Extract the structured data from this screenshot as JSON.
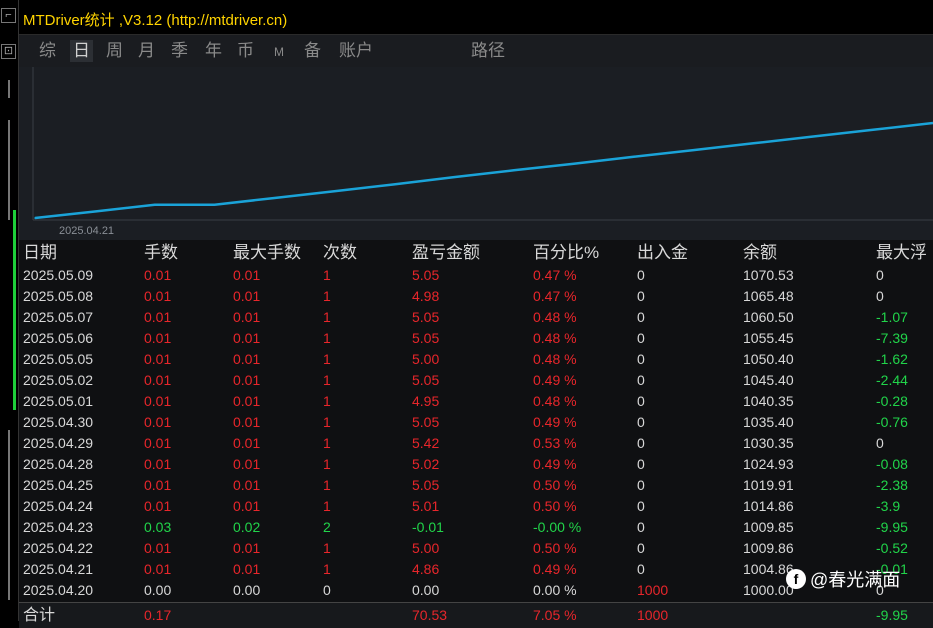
{
  "window": {
    "title": "MTDriver统计 ,V3.12 (http://mtdriver.cn)"
  },
  "tabs": [
    {
      "label": "综"
    },
    {
      "label": "日",
      "active": true
    },
    {
      "label": "周"
    },
    {
      "label": "月"
    },
    {
      "label": "季"
    },
    {
      "label": "年"
    },
    {
      "label": "币"
    },
    {
      "label": "M"
    },
    {
      "label": "备"
    },
    {
      "label": "账户"
    },
    {
      "label": "路径"
    }
  ],
  "chart_data": {
    "type": "line",
    "x": [
      "2025.04.20",
      "2025.04.21",
      "2025.04.22",
      "2025.04.23",
      "2025.04.24",
      "2025.04.25",
      "2025.04.28",
      "2025.04.29",
      "2025.04.30",
      "2025.05.01",
      "2025.05.02",
      "2025.05.05",
      "2025.05.06",
      "2025.05.07",
      "2025.05.08",
      "2025.05.09"
    ],
    "series": [
      {
        "values": [
          1000.0,
          1004.86,
          1009.86,
          1009.85,
          1014.86,
          1019.91,
          1024.93,
          1030.35,
          1035.4,
          1040.35,
          1045.4,
          1050.4,
          1055.45,
          1060.5,
          1065.48,
          1070.53
        ]
      }
    ],
    "start_label": "2025.04.21",
    "line_color": "#1aa3d8"
  },
  "table": {
    "headers": [
      "日期",
      "手数",
      "最大手数",
      "次数",
      "盈亏金额",
      "百分比%",
      "出入金",
      "余额",
      "最大浮"
    ],
    "rows": [
      [
        "2025.05.09",
        "0.01",
        "0.01",
        "1",
        "5.05",
        "0.47 %",
        "0",
        "1070.53",
        "0"
      ],
      [
        "2025.05.08",
        "0.01",
        "0.01",
        "1",
        "4.98",
        "0.47 %",
        "0",
        "1065.48",
        "0"
      ],
      [
        "2025.05.07",
        "0.01",
        "0.01",
        "1",
        "5.05",
        "0.48 %",
        "0",
        "1060.50",
        "-1.07"
      ],
      [
        "2025.05.06",
        "0.01",
        "0.01",
        "1",
        "5.05",
        "0.48 %",
        "0",
        "1055.45",
        "-7.39"
      ],
      [
        "2025.05.05",
        "0.01",
        "0.01",
        "1",
        "5.00",
        "0.48 %",
        "0",
        "1050.40",
        "-1.62"
      ],
      [
        "2025.05.02",
        "0.01",
        "0.01",
        "1",
        "5.05",
        "0.49 %",
        "0",
        "1045.40",
        "-2.44"
      ],
      [
        "2025.05.01",
        "0.01",
        "0.01",
        "1",
        "4.95",
        "0.48 %",
        "0",
        "1040.35",
        "-0.28"
      ],
      [
        "2025.04.30",
        "0.01",
        "0.01",
        "1",
        "5.05",
        "0.49 %",
        "0",
        "1035.40",
        "-0.76"
      ],
      [
        "2025.04.29",
        "0.01",
        "0.01",
        "1",
        "5.42",
        "0.53 %",
        "0",
        "1030.35",
        "0"
      ],
      [
        "2025.04.28",
        "0.01",
        "0.01",
        "1",
        "5.02",
        "0.49 %",
        "0",
        "1024.93",
        "-0.08"
      ],
      [
        "2025.04.25",
        "0.01",
        "0.01",
        "1",
        "5.05",
        "0.50 %",
        "0",
        "1019.91",
        "-2.38"
      ],
      [
        "2025.04.24",
        "0.01",
        "0.01",
        "1",
        "5.01",
        "0.50 %",
        "0",
        "1014.86",
        "-3.9"
      ],
      [
        "2025.04.23",
        "0.03",
        "0.02",
        "2",
        "-0.01",
        "-0.00 %",
        "0",
        "1009.85",
        "-9.95"
      ],
      [
        "2025.04.22",
        "0.01",
        "0.01",
        "1",
        "5.00",
        "0.50 %",
        "0",
        "1009.86",
        "-0.52"
      ],
      [
        "2025.04.21",
        "0.01",
        "0.01",
        "1",
        "4.86",
        "0.49 %",
        "0",
        "1004.86",
        "-0.01"
      ],
      [
        "2025.04.20",
        "0.00",
        "0.00",
        "0",
        "0.00",
        "0.00 %",
        "1000",
        "1000.00",
        "0"
      ]
    ],
    "total": [
      "合计",
      "0.17",
      "",
      "",
      "70.53",
      "7.05 %",
      "1000",
      "",
      "-9.95"
    ]
  },
  "watermark": {
    "logo": "f",
    "text": "@春光满面"
  },
  "colors": {
    "title": "#ffd400",
    "profit": "#e8262b",
    "loss": "#21d44a",
    "line": "#1aa3d8"
  }
}
